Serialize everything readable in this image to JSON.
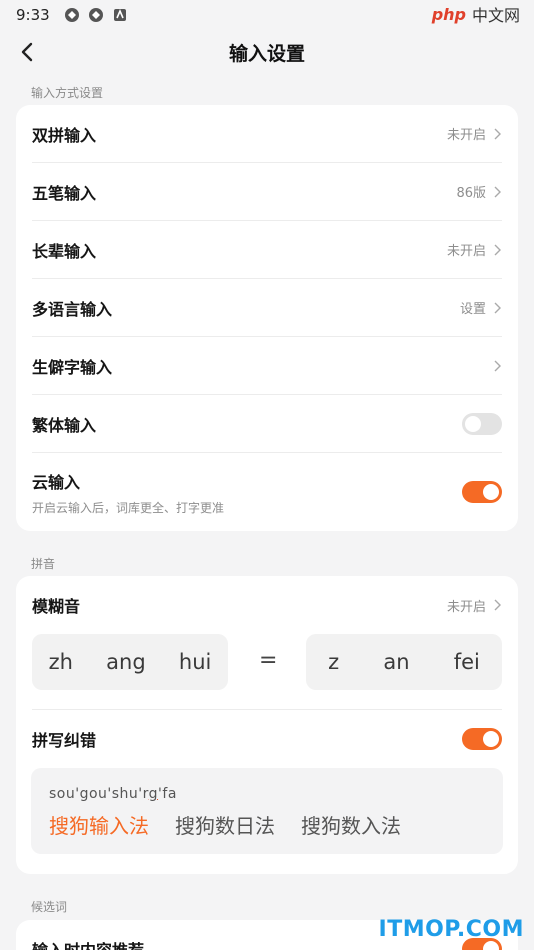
{
  "status_bar": {
    "time": "9:33",
    "watermark_php": "php",
    "watermark_cn": "中文网"
  },
  "nav": {
    "title": "输入设置"
  },
  "sections": {
    "input_methods_label": "输入方式设置",
    "pinyin_label": "拼音",
    "candidates_label": "候选词"
  },
  "input_methods": [
    {
      "title": "双拼输入",
      "value": "未开启"
    },
    {
      "title": "五笔输入",
      "value": "86版"
    },
    {
      "title": "长辈输入",
      "value": "未开启"
    },
    {
      "title": "多语言输入",
      "value": "设置"
    },
    {
      "title": "生僻字输入",
      "value": ""
    }
  ],
  "traditional": {
    "title": "繁体输入",
    "enabled": false
  },
  "cloud": {
    "title": "云输入",
    "subtitle": "开启云输入后，词库更全、打字更准",
    "enabled": true
  },
  "fuzzy": {
    "title": "模糊音",
    "value": "未开启",
    "left": [
      "zh",
      "ang",
      "hui"
    ],
    "equals": "=",
    "right": [
      "z",
      "an",
      "fei"
    ]
  },
  "spell": {
    "title": "拼写纠错",
    "enabled": true,
    "input_pre": "sou'gou'shu'r",
    "input_mark": "g",
    "input_post": "'fa",
    "candidates": [
      "搜狗输入法",
      "搜狗数日法",
      "搜狗数入法"
    ]
  },
  "recommend": {
    "title": "输入时内容推荐",
    "enabled": true
  },
  "watermark_bottom": "ITMOP.COM",
  "colors": {
    "accent": "#f56a25",
    "background": "#f4f4f5"
  }
}
